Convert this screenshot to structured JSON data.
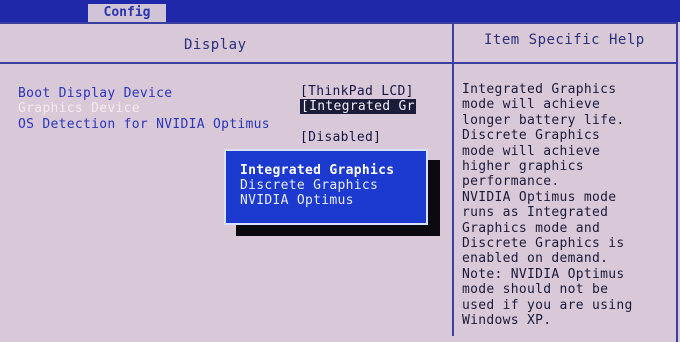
{
  "menu": {
    "tab_label": "Config"
  },
  "panel": {
    "title": "Display",
    "help_title": "Item Specific Help"
  },
  "settings": [
    {
      "label": "Boot Display Device",
      "value": "[ThinkPad LCD]"
    },
    {
      "label": "Graphics Device",
      "value": "[Integrated Gr"
    },
    {
      "label": "OS Detection for NVIDIA Optimus",
      "value": "[Disabled]"
    }
  ],
  "help_text": "Integrated Graphics\nmode will achieve\nlonger battery life.\nDiscrete Graphics\nmode will achieve\nhigher graphics\nperformance.\nNVIDIA Optimus mode\nruns as Integrated\nGraphics mode and\nDiscrete Graphics is\nenabled on demand.\nNote: NVIDIA Optimus\nmode should not be\nused if you are using\nWindows XP.",
  "popup": {
    "options": [
      "Integrated Graphics",
      "Discrete Graphics",
      "NVIDIA Optimus"
    ],
    "selected_index": 0
  },
  "colors": {
    "background": "#d9c8d8",
    "topbar": "#1e28a8",
    "popup": "#1c3ad0",
    "label_blue": "#2a35b8"
  }
}
